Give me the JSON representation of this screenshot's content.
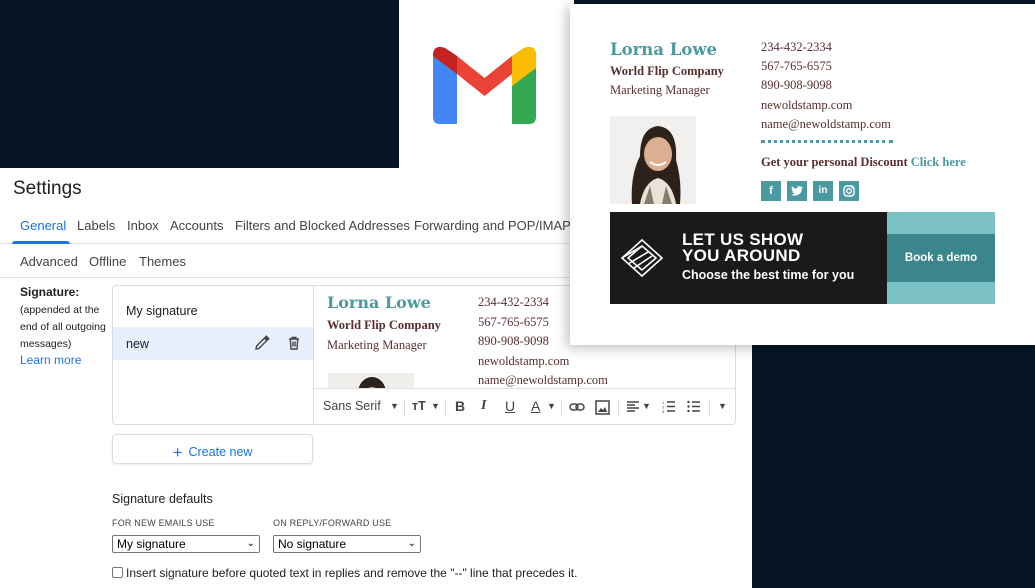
{
  "settings": {
    "title": "Settings",
    "tabs_row1": [
      "General",
      "Labels",
      "Inbox",
      "Accounts",
      "Filters and Blocked Addresses",
      "Forwarding and POP/IMAP"
    ],
    "tabs_row2": [
      "Advanced",
      "Offline",
      "Themes"
    ],
    "active_tab": "General",
    "signature_label": "Signature:",
    "signature_note": "(appended at the end of all outgoing messages)",
    "learn_more": "Learn more",
    "signatures": [
      {
        "name": "My signature",
        "selected": false
      },
      {
        "name": "new",
        "selected": true
      }
    ],
    "toolbar": {
      "font": "Sans Serif"
    },
    "create_new": "Create new",
    "defaults_title": "Signature defaults",
    "new_emails_label": "FOR NEW EMAILS USE",
    "new_emails_value": "My signature",
    "reply_label": "ON REPLY/FORWARD USE",
    "reply_value": "No signature",
    "insert_text": "Insert signature before quoted text in replies and remove the \"--\" line that precedes it."
  },
  "signature": {
    "name": "Lorna Lowe",
    "company": "World Flip Company",
    "role": "Marketing Manager",
    "phones": [
      "234-432-2334",
      "567-765-6575",
      "890-908-9098"
    ],
    "website": "newoldstamp.com",
    "email": "name@newoldstamp.com",
    "discount_text": "Get your personal Discount",
    "discount_link": "Click here",
    "social": [
      "f",
      "t",
      "in",
      "ig"
    ],
    "banner_title_1": "LET US SHOW",
    "banner_title_2": "YOU AROUND",
    "banner_sub": "Choose the best time for you",
    "banner_button": "Book a demo"
  },
  "colors": {
    "accent": "#1a73e8",
    "name": "#4b9aa2",
    "text": "#5a2f2f",
    "background": "#061626"
  }
}
